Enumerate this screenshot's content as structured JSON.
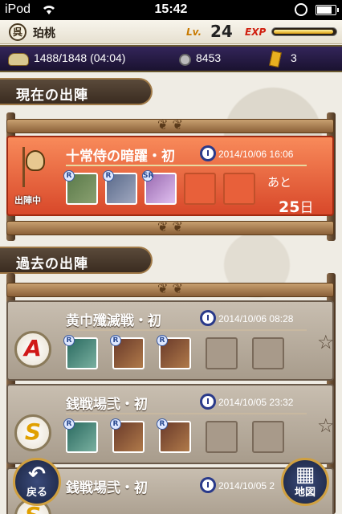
{
  "status": {
    "carrier": "iPod",
    "time": "15:42",
    "battery_level": 0.85
  },
  "player": {
    "avatar_glyph": "呉",
    "name": "珀桃",
    "lv_label": "Lv.",
    "level": "24",
    "exp_label": "EXP",
    "exp_progress": 0.97
  },
  "resources": {
    "stamina": "1488/1848 (04:04)",
    "coins": "8453",
    "tickets": "3"
  },
  "current_section": {
    "label": "現在の出陣"
  },
  "past_section": {
    "label": "過去の出陣"
  },
  "active_sortie": {
    "title": "十常侍の暗躍・初",
    "date": "2014/10/06 16:06",
    "status": "出陣中",
    "remaining_label": "あと",
    "remaining_days": "25",
    "days_unit": "日"
  },
  "past_sorties": [
    {
      "title": "黄巾殲滅戦・初",
      "date": "2014/10/06 08:28",
      "rank": "A"
    },
    {
      "title": "銭戦場弐・初",
      "date": "2014/10/05 23:32",
      "rank": "S"
    },
    {
      "title": "銭戦場弐・初",
      "date": "2014/10/05 2",
      "rank": "S"
    }
  ],
  "buttons": {
    "back": "戻る",
    "map": "地図"
  },
  "colors": {
    "accent": "#d8482a",
    "rank_a": "#d01818",
    "rank_s": "#e0a000"
  },
  "icons": {
    "stamina": "helmet-icon",
    "coin": "coin-icon",
    "ticket": "ticket-icon",
    "clock": "clock-icon",
    "star": "star-icon",
    "back": "arrow-back-icon",
    "map": "map-icon"
  }
}
